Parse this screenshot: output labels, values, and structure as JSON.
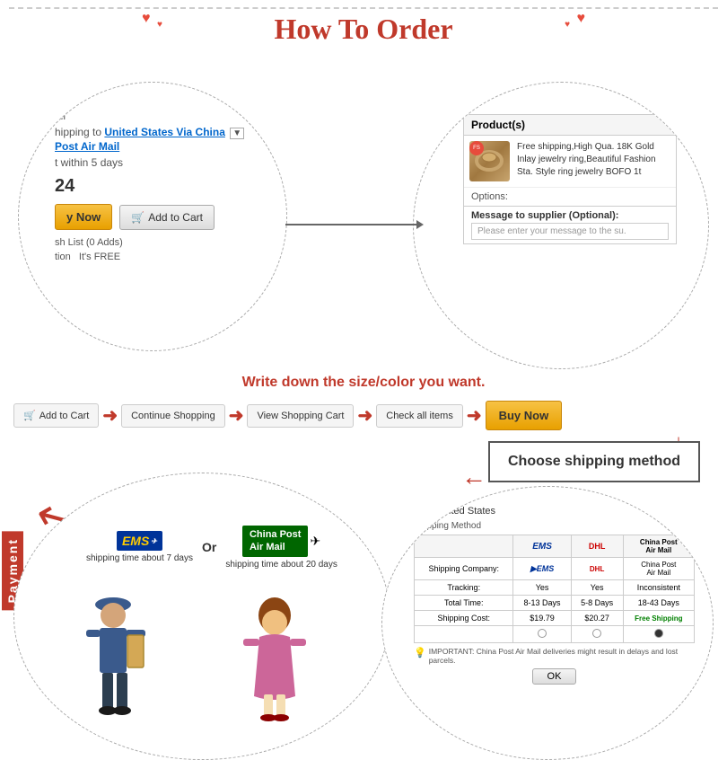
{
  "page": {
    "title": "How To Order",
    "top_note": "Write down the size/color you want."
  },
  "top_left_circle": {
    "shipping_to_label": "hipping to",
    "shipping_destination": "United States Via China",
    "post_air": "Post Air Mail",
    "delivery_time": "t within 5 days",
    "price": "24",
    "btn_buy_now": "y Now",
    "btn_add_cart": "Add to Cart",
    "wishlist": "sh List (0 Adds)",
    "protection_label": "tion",
    "protection_value": "It's FREE"
  },
  "top_right_circle": {
    "panel_header": "Product(s)",
    "product_description": "Free shipping,High Qua. 18K Gold Inlay jewelry ring,Beautiful Fashion Sta. Style ring jewelry BOFO 1t",
    "options_label": "Options:",
    "message_label": "Message to supplier (Optional):",
    "message_placeholder": "Please enter your message to the su."
  },
  "step_flow": {
    "step1": "Add to Cart",
    "step2": "Continue Shopping",
    "step3": "View Shopping Cart",
    "step4": "Check all items",
    "step5": "Buy Now"
  },
  "shipping_method_box": {
    "text": "Choose shipping method"
  },
  "bottom_left_circle": {
    "payment_label": "Payment",
    "ems_label": "EMS",
    "or_text": "Or",
    "china_post_label": "China Post Air Mail",
    "ems_time": "shipping time about 7 days",
    "china_post_time": "shipping time about 20 days"
  },
  "bottom_right_circle": {
    "country": "United States",
    "shipping_method_label": "Shipping Method",
    "table": {
      "headers": [
        "",
        "EMS",
        "DHL",
        "China Post Air Mail"
      ],
      "rows": [
        [
          "Shipping Company:",
          "EMS",
          "DHL",
          "China Post Air Mail"
        ],
        [
          "Tracking:",
          "Yes",
          "Yes",
          "Inconsistent"
        ],
        [
          "Total Time:",
          "8-13 Days",
          "5-8 Days",
          "18-43 Days"
        ],
        [
          "Shipping Cost:",
          "$19.79",
          "$20.27",
          "Free Shipping"
        ]
      ]
    },
    "important_note": "IMPORTANT: China Post Air Mail deliveries might result in delays and lost parcels.",
    "ok_btn": "OK"
  },
  "arrows": {
    "right": "→",
    "left": "←",
    "down": "↓"
  }
}
